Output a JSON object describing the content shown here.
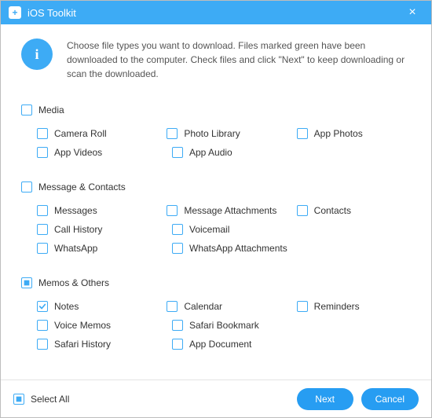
{
  "titlebar": {
    "app_icon_glyph": "+",
    "title": "iOS Toolkit",
    "close_glyph": "×"
  },
  "intro": {
    "info_glyph": "i",
    "text": "Choose file types you want to download. Files marked green have been downloaded to the computer. Check files and click \"Next\" to keep downloading or scan the downloaded."
  },
  "sections": {
    "media": {
      "header": "Media",
      "header_state": "unchecked",
      "rows": [
        [
          {
            "label": "Camera Roll",
            "state": "unchecked"
          },
          {
            "label": "Photo Library",
            "state": "unchecked"
          },
          {
            "label": "App Photos",
            "state": "unchecked"
          }
        ],
        [
          {
            "label": "App Videos",
            "state": "unchecked"
          },
          {
            "label": "App Audio",
            "state": "unchecked"
          },
          null
        ]
      ]
    },
    "message": {
      "header": "Message & Contacts",
      "header_state": "unchecked",
      "rows": [
        [
          {
            "label": "Messages",
            "state": "unchecked"
          },
          {
            "label": "Message Attachments",
            "state": "unchecked"
          },
          {
            "label": "Contacts",
            "state": "unchecked"
          }
        ],
        [
          {
            "label": "Call History",
            "state": "unchecked"
          },
          {
            "label": "Voicemail",
            "state": "unchecked"
          },
          null
        ],
        [
          {
            "label": "WhatsApp",
            "state": "unchecked"
          },
          {
            "label": "WhatsApp Attachments",
            "state": "unchecked"
          },
          null
        ]
      ]
    },
    "memos": {
      "header": "Memos & Others",
      "header_state": "indeterminate",
      "rows": [
        [
          {
            "label": "Notes",
            "state": "checked"
          },
          {
            "label": "Calendar",
            "state": "unchecked"
          },
          {
            "label": "Reminders",
            "state": "unchecked"
          }
        ],
        [
          {
            "label": "Voice Memos",
            "state": "unchecked"
          },
          {
            "label": "Safari Bookmark",
            "state": "unchecked"
          },
          null
        ],
        [
          {
            "label": "Safari History",
            "state": "unchecked"
          },
          {
            "label": "App Document",
            "state": "unchecked"
          },
          null
        ]
      ]
    }
  },
  "footer": {
    "select_all_label": "Select All",
    "select_all_state": "indeterminate",
    "next_label": "Next",
    "cancel_label": "Cancel"
  }
}
